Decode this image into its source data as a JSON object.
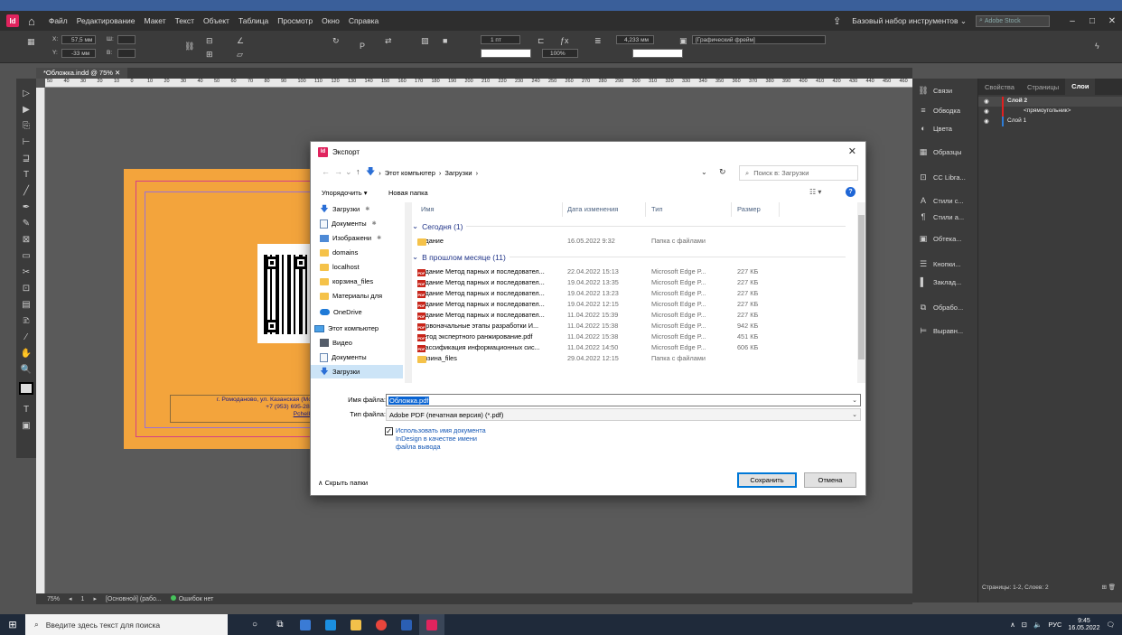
{
  "menubar": {
    "app_icon": "Id",
    "items": [
      "Файл",
      "Редактирование",
      "Макет",
      "Текст",
      "Объект",
      "Таблица",
      "Просмотр",
      "Окно",
      "Справка"
    ],
    "workspace": "Базовый набор инструментов",
    "stock_placeholder": "Adobe Stock"
  },
  "controlbar": {
    "x_label": "X:",
    "x_value": "57,5 мм",
    "y_label": "Y:",
    "y_value": "-33 мм",
    "w_label": "Ш:",
    "h_label": "В:",
    "stroke_weight": "1 пт",
    "zoom_pct": "100%",
    "dim_value": "4,233 мм",
    "frame_style": "[Графический фрейм]"
  },
  "document": {
    "tab_label": "*Обложка.indd @ 75%",
    "address_line1": "г. Ромоданово, ул. Казанская (Мо",
    "address_line2": "+7 (953) 695-28-",
    "address_link": "Pchelk"
  },
  "ruler_h": [
    "50",
    "40",
    "30",
    "20",
    "10",
    "0",
    "10",
    "20",
    "30",
    "40",
    "50",
    "60",
    "70",
    "80",
    "90",
    "100",
    "110",
    "120",
    "130",
    "140",
    "150",
    "160",
    "170",
    "180",
    "190",
    "200",
    "210",
    "220",
    "230",
    "240",
    "250",
    "260",
    "270",
    "280",
    "290",
    "300",
    "310",
    "320",
    "330",
    "340",
    "350",
    "360",
    "370",
    "380",
    "390",
    "400",
    "410",
    "420",
    "430",
    "440",
    "450",
    "460"
  ],
  "statusbar": {
    "zoom": "75%",
    "page": "1",
    "base": "[Основной] (рабо...",
    "errors": "Ошибок нет"
  },
  "right_panels": [
    "Связи",
    "Обводка",
    "Цвета",
    "Образцы",
    "CC Libra...",
    "Стили с...",
    "Стили а...",
    "Обтека...",
    "Кнопки...",
    "Заклад...",
    "Обрабо...",
    "Выравн..."
  ],
  "layers": {
    "tabs": [
      "Свойства",
      "Страницы",
      "Слои"
    ],
    "rows": [
      "Слой 2",
      "<прямоугольник>",
      "Слой 1"
    ],
    "footer": "Страницы: 1-2, Слоев: 2"
  },
  "dialog": {
    "title": "Экспорт",
    "breadcrumb": [
      "Этот компьютер",
      "Загрузки"
    ],
    "search_placeholder": "Поиск в: Загрузки",
    "organize": "Упорядочить ▾",
    "new_folder": "Новая папка",
    "nav_items": [
      {
        "label": "Загрузки",
        "icon": "download-icon",
        "pinned": true
      },
      {
        "label": "Документы",
        "icon": "documents-icon",
        "pinned": true
      },
      {
        "label": "Изображени",
        "icon": "images-icon",
        "pinned": true
      },
      {
        "label": "domains",
        "icon": "folder-icon",
        "pinned": false
      },
      {
        "label": "localhost",
        "icon": "folder-icon",
        "pinned": false
      },
      {
        "label": "корзина_files",
        "icon": "folder-icon",
        "pinned": false
      },
      {
        "label": "Материалы для",
        "icon": "folder-icon",
        "pinned": false
      },
      {
        "label": "OneDrive",
        "icon": "cloud-icon",
        "pinned": false
      },
      {
        "label": "Этот компьютер",
        "icon": "computer-icon",
        "pinned": false
      },
      {
        "label": "Видео",
        "icon": "video-icon",
        "pinned": false
      },
      {
        "label": "Документы",
        "icon": "documents-icon",
        "pinned": false
      },
      {
        "label": "Загрузки",
        "icon": "download-icon",
        "pinned": false
      }
    ],
    "columns": [
      "Имя",
      "Дата изменения",
      "Тип",
      "Размер"
    ],
    "groups": [
      {
        "label": "Сегодня (1)",
        "files": [
          {
            "name": "Задание",
            "date": "16.05.2022 9:32",
            "type": "Папка с файлами",
            "size": "",
            "kind": "folder"
          }
        ]
      },
      {
        "label": "В прошлом месяце (11)",
        "files": [
          {
            "name": "Задание Метод парных и последовател...",
            "date": "22.04.2022 15:13",
            "type": "Microsoft Edge P...",
            "size": "227 КБ",
            "kind": "pdf"
          },
          {
            "name": "Задание Метод парных и последовател...",
            "date": "19.04.2022 13:35",
            "type": "Microsoft Edge P...",
            "size": "227 КБ",
            "kind": "pdf"
          },
          {
            "name": "Задание Метод парных и последовател...",
            "date": "19.04.2022 13:23",
            "type": "Microsoft Edge P...",
            "size": "227 КБ",
            "kind": "pdf"
          },
          {
            "name": "Задание Метод парных и последовател...",
            "date": "19.04.2022 12:15",
            "type": "Microsoft Edge P...",
            "size": "227 КБ",
            "kind": "pdf"
          },
          {
            "name": "Задание Метод парных и последовател...",
            "date": "11.04.2022 15:39",
            "type": "Microsoft Edge P...",
            "size": "227 КБ",
            "kind": "pdf"
          },
          {
            "name": "Первоначальные этапы разработки И...",
            "date": "11.04.2022 15:38",
            "type": "Microsoft Edge P...",
            "size": "942 КБ",
            "kind": "pdf"
          },
          {
            "name": "Метод экспертного ранжирование.pdf",
            "date": "11.04.2022 15:38",
            "type": "Microsoft Edge P...",
            "size": "451 КБ",
            "kind": "pdf"
          },
          {
            "name": "Классификация информационных сис...",
            "date": "11.04.2022 14:50",
            "type": "Microsoft Edge P...",
            "size": "606 КБ",
            "kind": "pdf"
          },
          {
            "name": "корзина_files",
            "date": "29.04.2022 12:15",
            "type": "Папка с файлами",
            "size": "",
            "kind": "folder"
          }
        ]
      }
    ],
    "filename_label": "Имя файла:",
    "filename_value": "Обложка.pdf",
    "filetype_label": "Тип файла:",
    "filetype_value": "Adobe PDF (печатная версия) (*.pdf)",
    "checkbox_text": "Использовать имя документа InDesign в качестве имени файла вывода",
    "hide_folders": "Скрыть папки",
    "save": "Сохранить",
    "cancel": "Отмена"
  },
  "taskbar": {
    "search_placeholder": "Введите здесь текст для поиска",
    "lang": "РУС",
    "time": "9:45",
    "date": "16.05.2022"
  }
}
